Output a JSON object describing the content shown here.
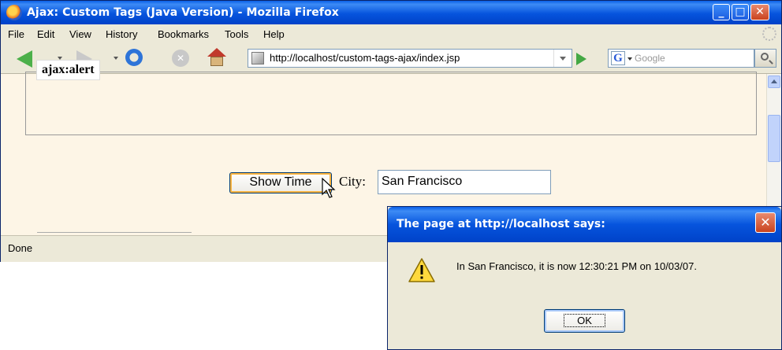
{
  "window": {
    "title": "Ajax: Custom Tags (Java Version) - Mozilla Firefox",
    "buttons": {
      "minimize": "_",
      "maximize": "□",
      "close": "✕"
    }
  },
  "menu": {
    "items": [
      "File",
      "Edit",
      "View",
      "History",
      "Bookmarks",
      "Tools",
      "Help"
    ]
  },
  "navigation": {
    "url": "http://localhost/custom-tags-ajax/index.jsp",
    "search_placeholder": "Google",
    "search_engine_letter": "G",
    "icons": [
      "back-icon",
      "forward-icon",
      "reload-icon",
      "stop-icon",
      "home-icon",
      "go-icon",
      "search-icon"
    ]
  },
  "page": {
    "legend": "ajax:alert",
    "show_time_label": "Show Time",
    "city_label": "City:",
    "city_value": "San Francisco"
  },
  "status": {
    "text": "Done"
  },
  "dialog": {
    "title": "The page at http://localhost says:",
    "message": "In San Francisco, it is now 12:30:21 PM on 10/03/07.",
    "ok_label": "OK",
    "close": "✕"
  },
  "colors": {
    "titlebar_blue": "#0654DD",
    "page_background": "#FDF5E6",
    "chrome": "#ECE9D8",
    "close_red": "#C9421E"
  }
}
